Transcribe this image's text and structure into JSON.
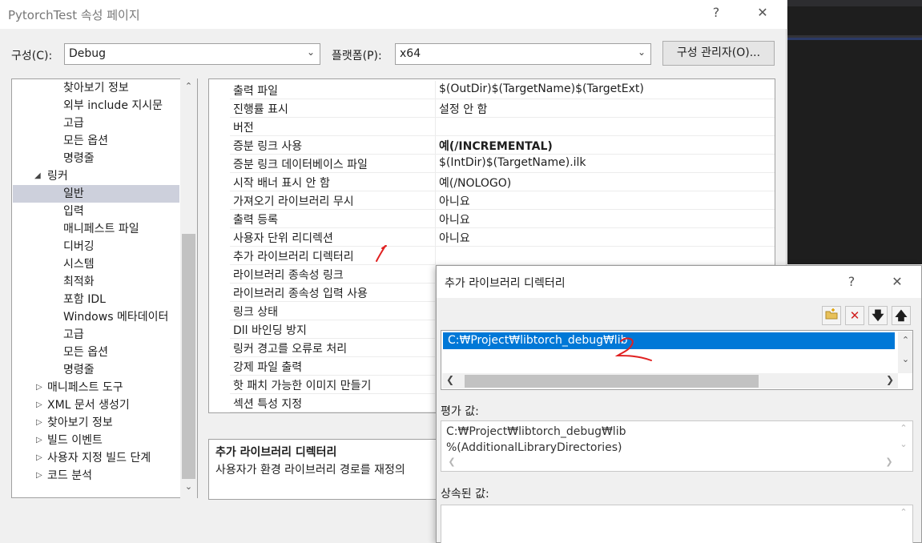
{
  "main_dialog": {
    "title": "PytorchTest 속성 페이지",
    "help_button": "?",
    "close_button": "✕",
    "config_label": "구성(C):",
    "config_value": "Debug",
    "platform_label": "플랫폼(P):",
    "platform_value": "x64",
    "config_manager_button": "구성 관리자(O)..."
  },
  "tree": {
    "items": [
      {
        "label": "찾아보기 정보",
        "level": 2
      },
      {
        "label": "외부 include 지시문",
        "level": 2
      },
      {
        "label": "고급",
        "level": 2
      },
      {
        "label": "모든 옵션",
        "level": 2
      },
      {
        "label": "명령줄",
        "level": 2
      },
      {
        "label": "링커",
        "level": 1,
        "expanded": true
      },
      {
        "label": "일반",
        "level": 2,
        "selected": true
      },
      {
        "label": "입력",
        "level": 2
      },
      {
        "label": "매니페스트 파일",
        "level": 2
      },
      {
        "label": "디버깅",
        "level": 2
      },
      {
        "label": "시스템",
        "level": 2
      },
      {
        "label": "최적화",
        "level": 2
      },
      {
        "label": "포함 IDL",
        "level": 2
      },
      {
        "label": "Windows 메타데이터",
        "level": 2
      },
      {
        "label": "고급",
        "level": 2
      },
      {
        "label": "모든 옵션",
        "level": 2
      },
      {
        "label": "명령줄",
        "level": 2
      },
      {
        "label": "매니페스트 도구",
        "level": 1
      },
      {
        "label": "XML 문서 생성기",
        "level": 1
      },
      {
        "label": "찾아보기 정보",
        "level": 1
      },
      {
        "label": "빌드 이벤트",
        "level": 1
      },
      {
        "label": "사용자 지정 빌드 단계",
        "level": 1
      },
      {
        "label": "코드 분석",
        "level": 1
      }
    ]
  },
  "grid": {
    "rows": [
      {
        "name": "출력 파일",
        "value": "$(OutDir)$(TargetName)$(TargetExt)"
      },
      {
        "name": "진행률 표시",
        "value": "설정 안 함"
      },
      {
        "name": "버전",
        "value": ""
      },
      {
        "name": "증분 링크 사용",
        "value": "예(/INCREMENTAL)",
        "bold": true
      },
      {
        "name": "증분 링크 데이터베이스 파일",
        "value": "$(IntDir)$(TargetName).ilk"
      },
      {
        "name": "시작 배너 표시 안 함",
        "value": "예(/NOLOGO)"
      },
      {
        "name": "가져오기 라이브러리 무시",
        "value": "아니요"
      },
      {
        "name": "출력 등록",
        "value": "아니요"
      },
      {
        "name": "사용자 단위 리디렉션",
        "value": "아니요"
      },
      {
        "name": "추가 라이브러리 디렉터리",
        "value": ""
      },
      {
        "name": "라이브러리 종속성 링크",
        "value": ""
      },
      {
        "name": "라이브러리 종속성 입력 사용",
        "value": ""
      },
      {
        "name": "링크 상태",
        "value": ""
      },
      {
        "name": "Dll 바인딩 방지",
        "value": ""
      },
      {
        "name": "링커 경고를 오류로 처리",
        "value": ""
      },
      {
        "name": "강제 파일 출력",
        "value": ""
      },
      {
        "name": "핫 패치 가능한 이미지 만들기",
        "value": ""
      },
      {
        "name": "섹션 특성 지정",
        "value": ""
      }
    ]
  },
  "description": {
    "title": "추가 라이브러리 디렉터리",
    "text": "사용자가 환경 라이브러리 경로를 재정의"
  },
  "child_dialog": {
    "title": "추가 라이브러리 디렉터리",
    "help_button": "?",
    "close_button": "✕",
    "list_items": [
      "C:₩Project₩libtorch_debug₩lib"
    ],
    "evaluated_label": "평가 값:",
    "evaluated_lines": [
      "C:₩Project₩libtorch_debug₩lib",
      "%(AdditionalLibraryDirectories)"
    ],
    "inherited_label": "상속된 값:"
  },
  "annotations": {
    "mark_1": "1",
    "mark_2": "2",
    "color": "#e02020"
  },
  "colors": {
    "selection_blue": "#0078d7",
    "tree_selection": "#cdd0dc"
  }
}
